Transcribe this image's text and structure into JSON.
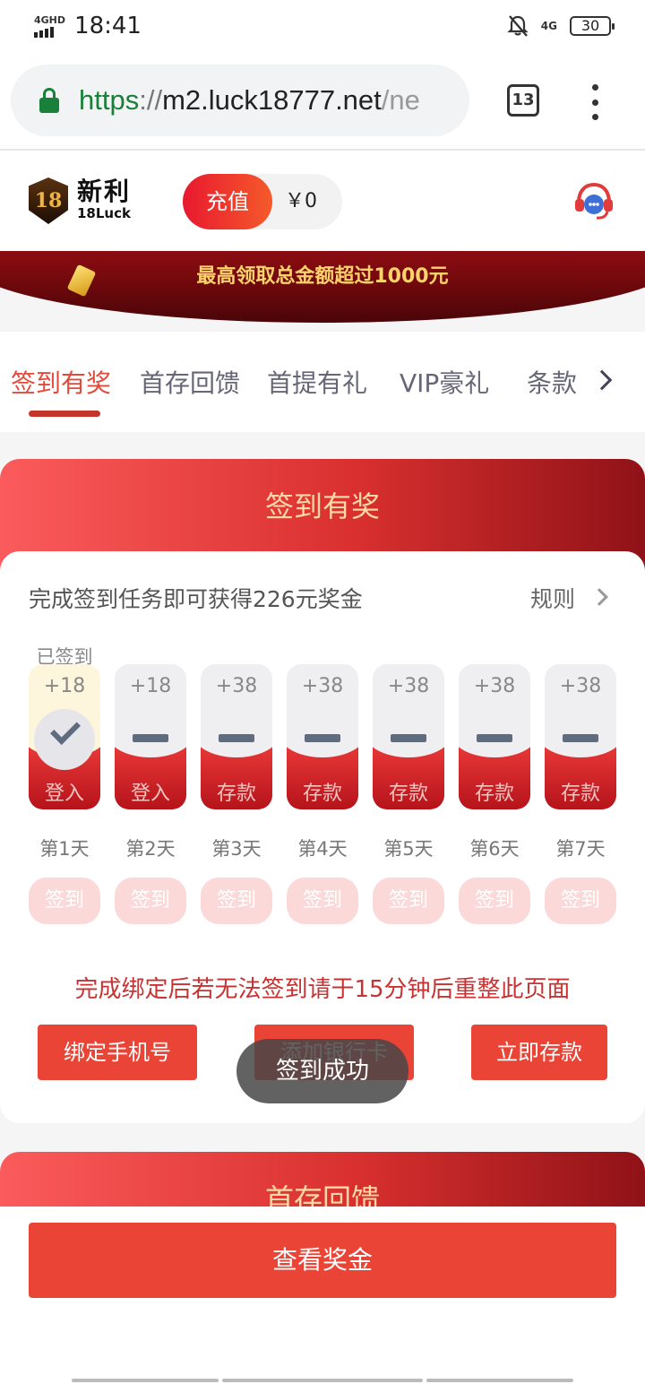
{
  "status_bar": {
    "network": "4GHD",
    "time": "18:41",
    "mobile": "4G",
    "battery": "30"
  },
  "browser": {
    "url_scheme": "https",
    "url_sep": "://",
    "url_host": "m2.luck18777.net",
    "url_path": "/ne",
    "tab_count": "13"
  },
  "header": {
    "logo_badge": "18",
    "logo_cn": "新利",
    "logo_en": "18Luck",
    "recharge": "充值",
    "balance": "￥0"
  },
  "banner": {
    "text": "最高领取总金额超过1000元"
  },
  "tabs": [
    "签到有奖",
    "首存回馈",
    "首提有礼",
    "VIP豪礼",
    "条款"
  ],
  "checkin": {
    "title": "签到有奖",
    "task_text": "完成签到任务即可获得226元奖金",
    "rules": "规则",
    "signed_label": "已签到",
    "days": [
      {
        "amount": "+18",
        "action": "登入",
        "label": "第1天",
        "button": "签到",
        "done": true
      },
      {
        "amount": "+18",
        "action": "登入",
        "label": "第2天",
        "button": "签到",
        "done": false
      },
      {
        "amount": "+38",
        "action": "存款",
        "label": "第3天",
        "button": "签到",
        "done": false
      },
      {
        "amount": "+38",
        "action": "存款",
        "label": "第4天",
        "button": "签到",
        "done": false
      },
      {
        "amount": "+38",
        "action": "存款",
        "label": "第5天",
        "button": "签到",
        "done": false
      },
      {
        "amount": "+38",
        "action": "存款",
        "label": "第6天",
        "button": "签到",
        "done": false
      },
      {
        "amount": "+38",
        "action": "存款",
        "label": "第7天",
        "button": "签到",
        "done": false
      }
    ],
    "bind_warning": "完成绑定后若无法签到请于15分钟后重整此页面",
    "btn_bind_phone": "绑定手机号",
    "btn_add_card": "添加银行卡",
    "btn_deposit": "立即存款"
  },
  "toast": "签到成功",
  "second_card": {
    "title": "首存回馈"
  },
  "bottom": {
    "view_bonus": "查看奖金"
  },
  "colors": {
    "accent": "#ea4436",
    "gold": "#ffd9a3",
    "dark_red": "#8f1217"
  }
}
